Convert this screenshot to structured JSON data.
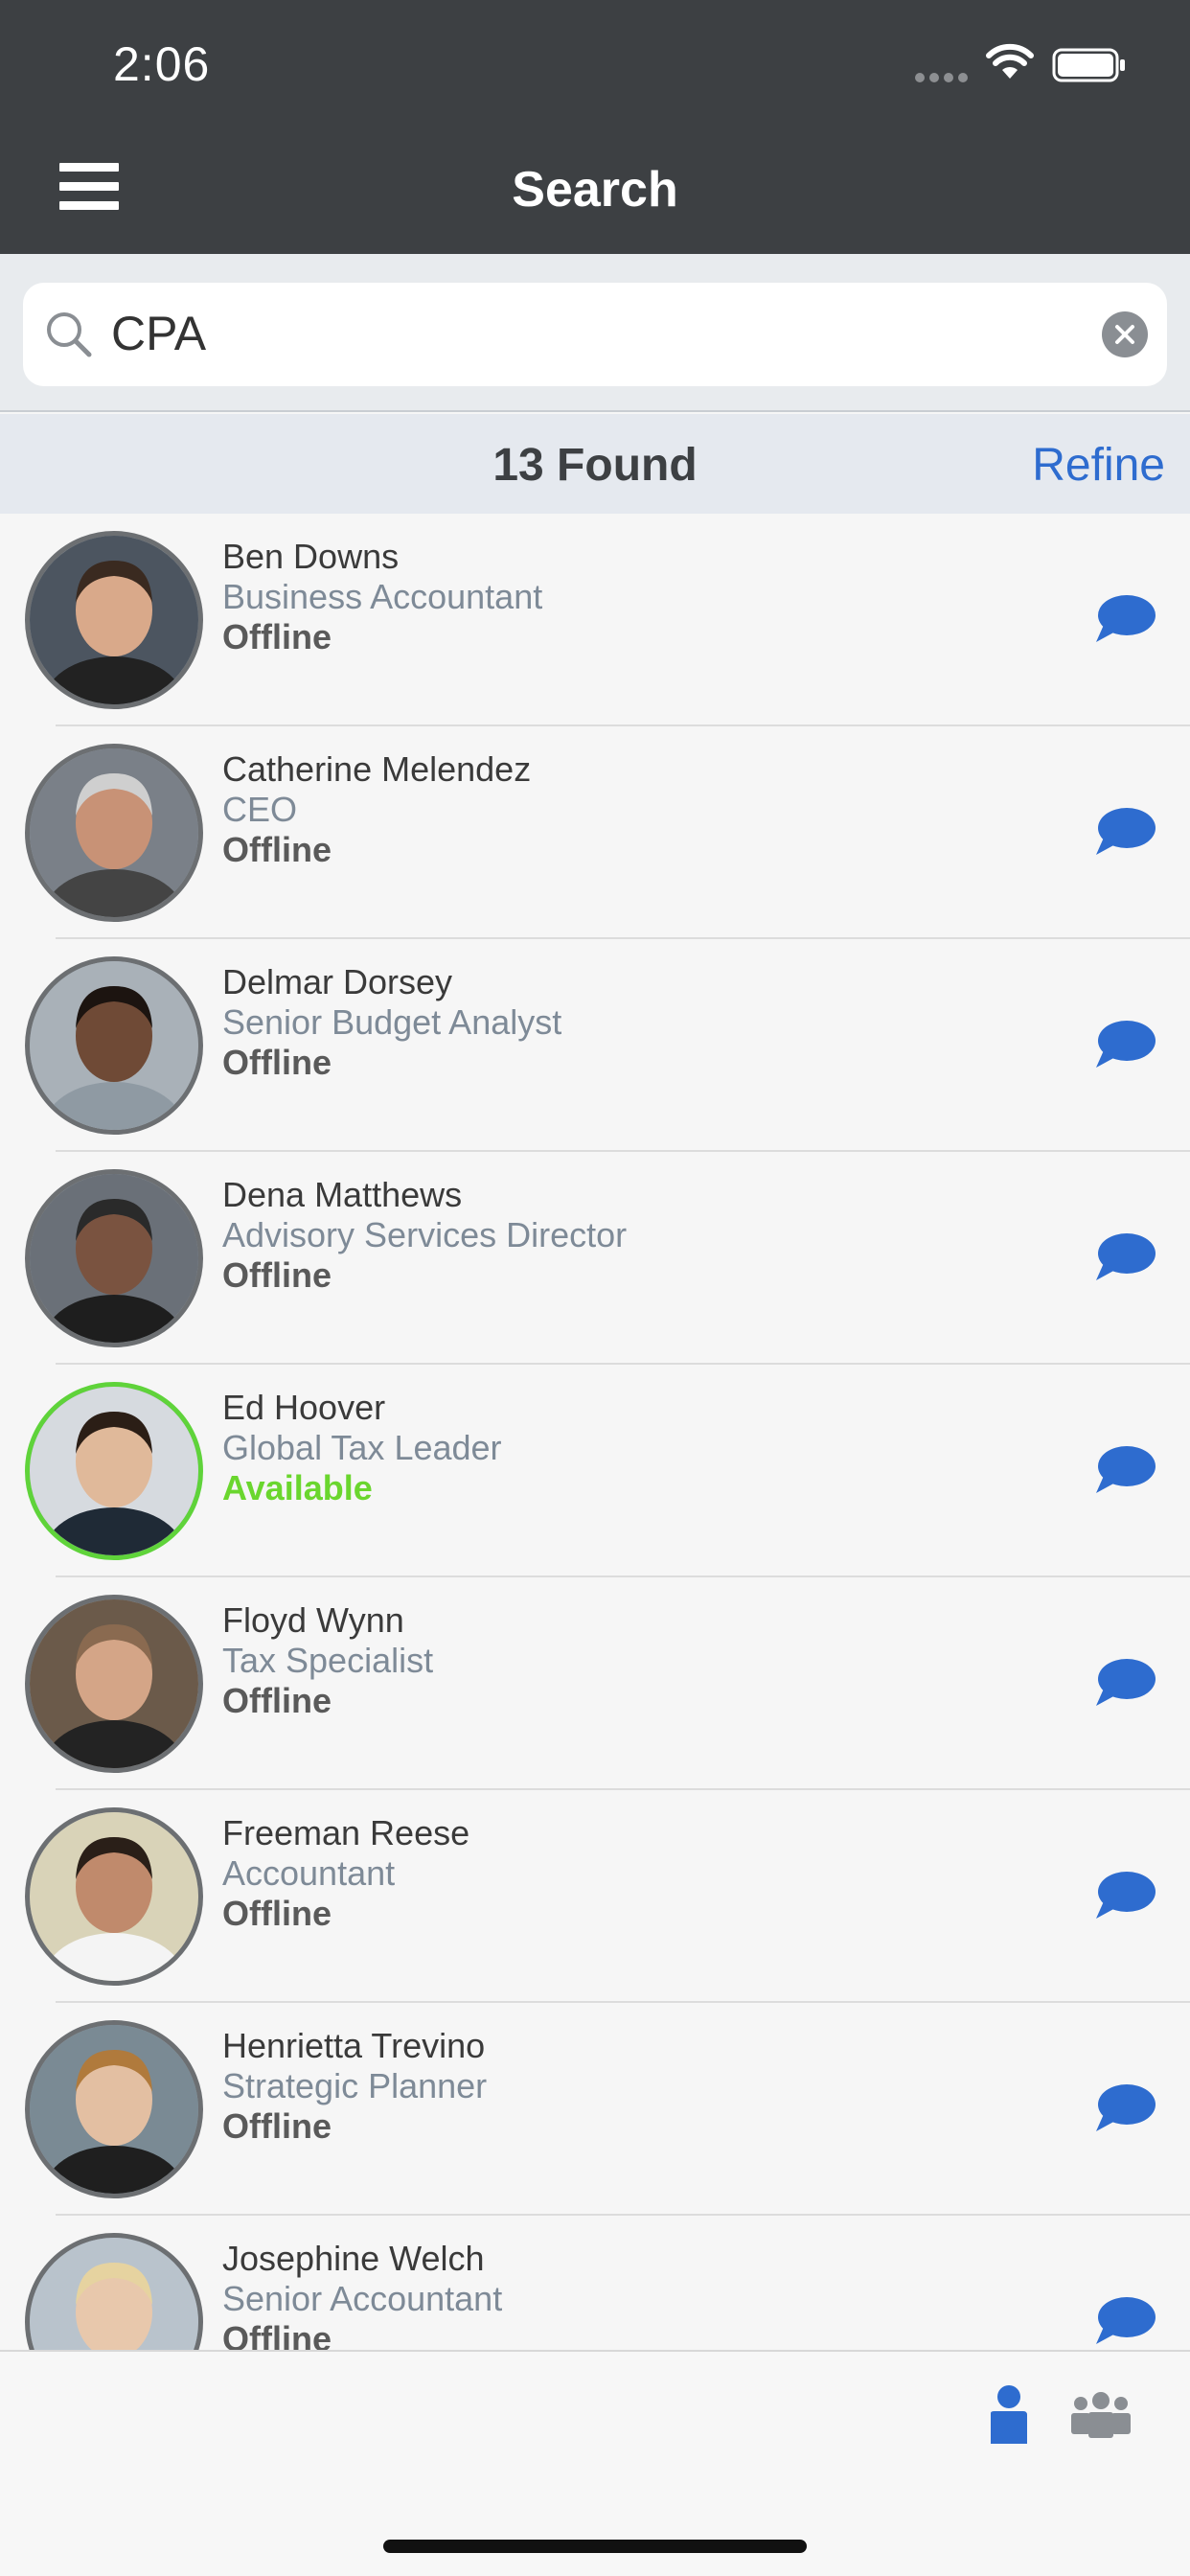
{
  "status_bar": {
    "time": "2:06"
  },
  "header": {
    "title": "Search"
  },
  "search": {
    "value": "CPA",
    "placeholder": "Search"
  },
  "results": {
    "count_label": "13 Found",
    "refine_label": "Refine"
  },
  "people": [
    {
      "name": "Ben Downs",
      "title": "Business Accountant",
      "status": "Offline",
      "available": false
    },
    {
      "name": "Catherine Melendez",
      "title": "CEO",
      "status": "Offline",
      "available": false
    },
    {
      "name": "Delmar Dorsey",
      "title": "Senior Budget Analyst",
      "status": "Offline",
      "available": false
    },
    {
      "name": "Dena Matthews",
      "title": "Advisory Services Director",
      "status": "Offline",
      "available": false
    },
    {
      "name": "Ed Hoover",
      "title": "Global Tax Leader",
      "status": "Available",
      "available": true
    },
    {
      "name": "Floyd Wynn",
      "title": "Tax Specialist",
      "status": "Offline",
      "available": false
    },
    {
      "name": "Freeman Reese",
      "title": "Accountant",
      "status": "Offline",
      "available": false
    },
    {
      "name": "Henrietta Trevino",
      "title": "Strategic Planner",
      "status": "Offline",
      "available": false
    },
    {
      "name": "Josephine Welch",
      "title": "Senior Accountant",
      "status": "Offline",
      "available": false
    }
  ],
  "colors": {
    "header_bg": "#3d4043",
    "accent": "#2e6ccf",
    "available": "#6ad62e",
    "offline_ring": "#6c6f72",
    "title_text": "#7e8a97"
  },
  "icons": {
    "menu": "hamburger-icon",
    "search": "magnifier-icon",
    "clear": "clear-x-icon",
    "chat": "chat-bubble-icon",
    "tab_person": "person-icon",
    "tab_group": "group-icon"
  }
}
